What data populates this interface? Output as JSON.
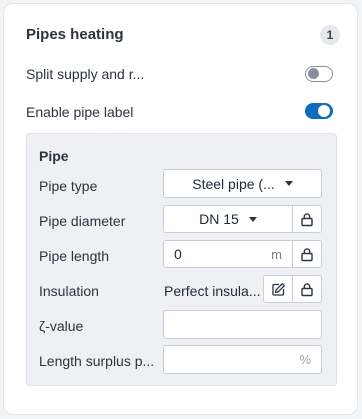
{
  "section": {
    "title": "Pipes heating",
    "badge": "1"
  },
  "options": {
    "split_label": "Split supply and r...",
    "split_enabled": false,
    "pipe_label_label": "Enable pipe label",
    "pipe_label_enabled": true
  },
  "pipe": {
    "title": "Pipe",
    "type_label": "Pipe type",
    "type_value": "Steel pipe (...",
    "diameter_label": "Pipe diameter",
    "diameter_value": "DN 15",
    "length_label": "Pipe length",
    "length_value": "0",
    "length_unit": "m",
    "insulation_label": "Insulation",
    "insulation_value": "Perfect insula...",
    "zeta_label": "ζ-value",
    "zeta_value": "",
    "surplus_label": "Length surplus p...",
    "surplus_value": "",
    "surplus_unit": "%"
  },
  "icons": {
    "lock": "lock-icon",
    "edit": "edit-icon",
    "caret": "caret-down-icon"
  },
  "colors": {
    "accent": "#0f6cbd",
    "group_bg": "#eef0f3"
  }
}
